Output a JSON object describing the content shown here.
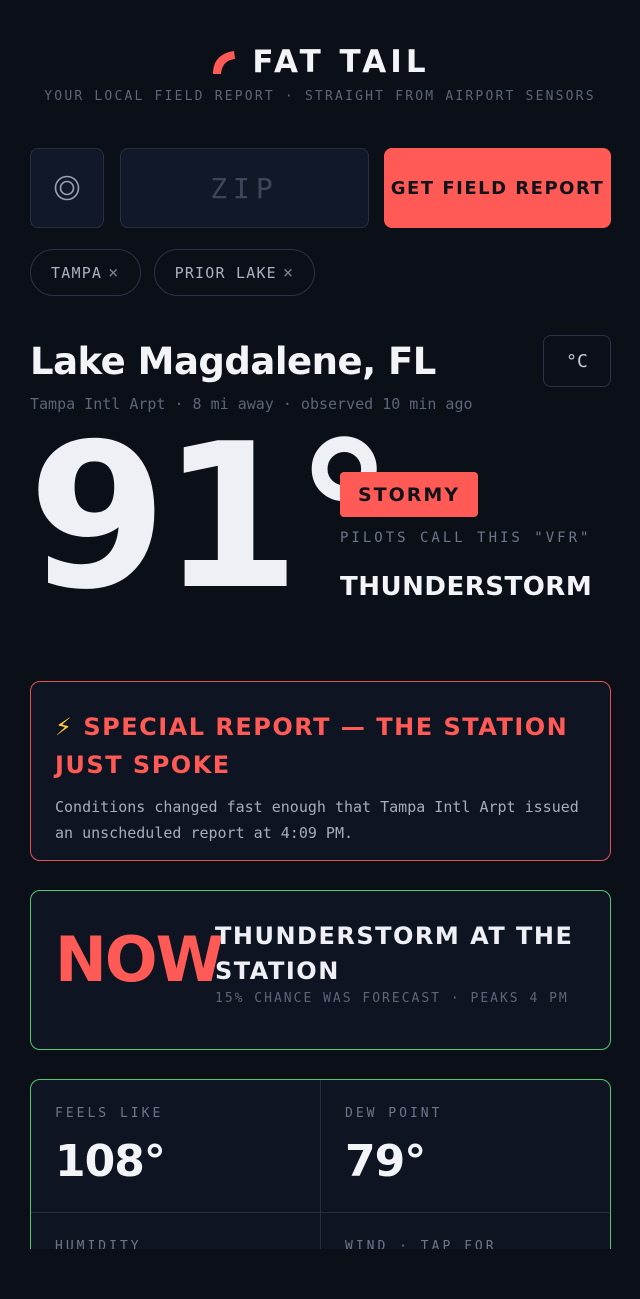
{
  "header": {
    "title": "FAT TAIL",
    "tagline": "YOUR LOCAL FIELD REPORT · STRAIGHT FROM AIRPORT SENSORS",
    "brand_color": "#ff5a55"
  },
  "search": {
    "locate_icon": "target-icon",
    "zip_placeholder": "ZIP",
    "zip_value": "",
    "submit_label": "GET FIELD REPORT"
  },
  "saved_locations": [
    {
      "label": "TAMPA",
      "remove_glyph": "×"
    },
    {
      "label": "PRIOR LAKE",
      "remove_glyph": "×"
    }
  ],
  "location": {
    "name": "Lake Magdalene, FL",
    "meta": "Tampa Intl Arpt · 8 mi away · observed 10 min ago",
    "unit_toggle": "°C"
  },
  "current": {
    "temperature": "91°",
    "badge": "STORMY",
    "pilot_note": "PILOTS CALL THIS \"VFR\"",
    "condition": "THUNDERSTORM"
  },
  "special_report": {
    "icon": "lightning-icon",
    "icon_glyph": "⚡",
    "title": "SPECIAL REPORT — THE STATION JUST SPOKE",
    "body": "Conditions changed fast enough that Tampa Intl Arpt issued an unscheduled report at 4:09 PM."
  },
  "now_card": {
    "label": "NOW",
    "title": "THUNDERSTORM AT THE STATION",
    "subtitle": "15% CHANCE WAS FORECAST · PEAKS 4 PM"
  },
  "stats": [
    {
      "label": "FEELS LIKE",
      "value": "108°"
    },
    {
      "label": "DEW POINT",
      "value": "79°"
    },
    {
      "label": "HUMIDITY",
      "value": ""
    },
    {
      "label": "WIND · TAP FOR",
      "value": ""
    }
  ]
}
